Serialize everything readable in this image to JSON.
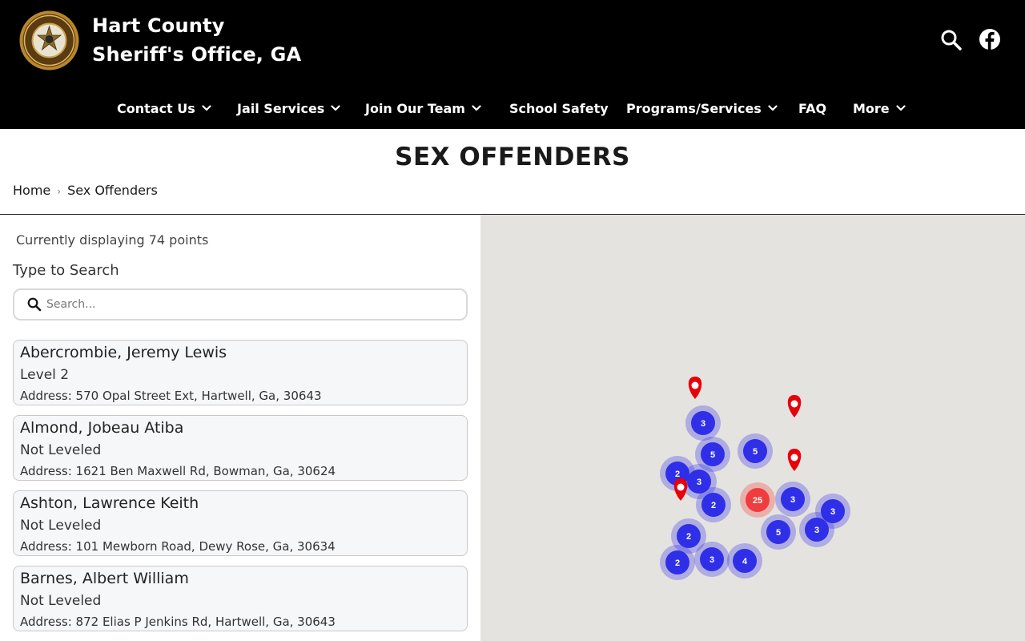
{
  "header": {
    "title_line1": "Hart County",
    "title_line2": "Sheriff's Office, GA",
    "logo_icon": "sheriff-badge-icon",
    "search_icon": "search-icon",
    "facebook_icon": "facebook-icon",
    "background_color": "#000000"
  },
  "nav": {
    "items": [
      {
        "label": "Contact Us",
        "has_dropdown": true
      },
      {
        "label": "Jail Services",
        "has_dropdown": true
      },
      {
        "label": "Join Our Team",
        "has_dropdown": true
      },
      {
        "label": "School Safety",
        "has_dropdown": false
      },
      {
        "label": "Programs/Services",
        "has_dropdown": true
      },
      {
        "label": "FAQ",
        "has_dropdown": false
      },
      {
        "label": "More",
        "has_dropdown": true
      }
    ]
  },
  "page": {
    "title": "SEX OFFENDERS"
  },
  "breadcrumb": {
    "home": "Home",
    "current": "Sex Offenders"
  },
  "sidebar": {
    "count_text": "Currently displaying 74 points",
    "search_label": "Type to Search",
    "search_placeholder": "Search...",
    "offenders": [
      {
        "name": "Abercrombie, Jeremy Lewis",
        "level": "Level 2",
        "address": "Address: 570 Opal Street Ext, Hartwell, Ga, 30643"
      },
      {
        "name": "Almond, Jobeau Atiba",
        "level": "Not Leveled",
        "address": "Address: 1621 Ben Maxwell Rd, Bowman, Ga, 30624"
      },
      {
        "name": "Ashton, Lawrence Keith",
        "level": "Not Leveled",
        "address": "Address: 101 Mewborn Road, Dewy Rose, Ga, 30634"
      },
      {
        "name": "Barnes, Albert William",
        "level": "Not Leveled",
        "address": "Address: 872 Elias P Jenkins Rd, Hartwell, Ga, 30643"
      }
    ]
  },
  "map": {
    "background_color": "#e5e3df",
    "cluster_color": "#2f2fe8",
    "hot_cluster_color": "#f03c3c",
    "pin_color": "#e8000b",
    "clusters": [
      {
        "count": "3"
      },
      {
        "count": "5"
      },
      {
        "count": "5"
      },
      {
        "count": "2"
      },
      {
        "count": "3"
      },
      {
        "count": "2"
      },
      {
        "count": "25"
      },
      {
        "count": "3"
      },
      {
        "count": "3"
      },
      {
        "count": "5"
      },
      {
        "count": "3"
      },
      {
        "count": "2"
      },
      {
        "count": "2"
      },
      {
        "count": "3"
      },
      {
        "count": "4"
      }
    ],
    "pins": 4
  }
}
